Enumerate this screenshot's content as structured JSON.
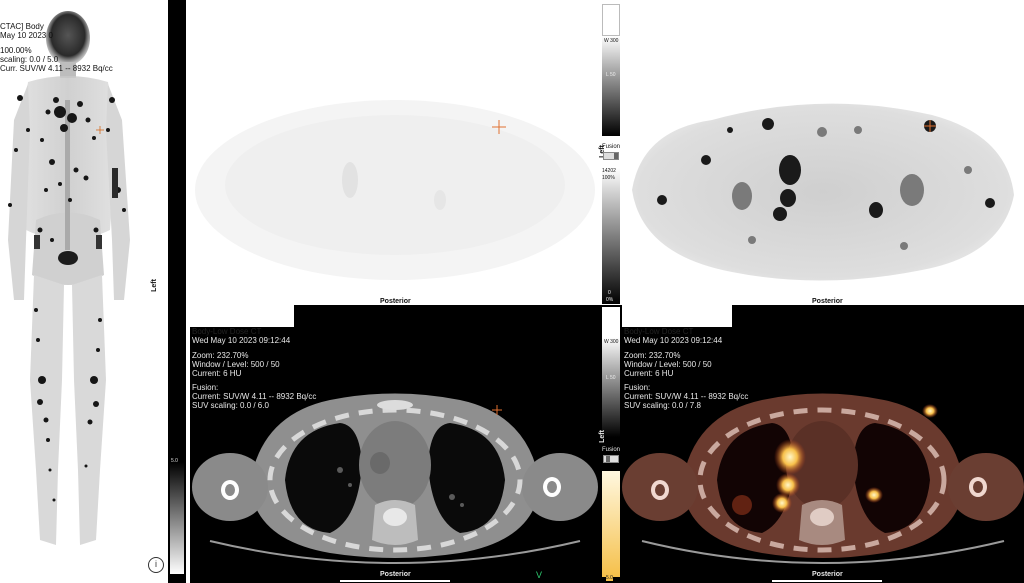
{
  "mip": {
    "header": {
      "line1": "CTAC] Body",
      "line2": "May 10 2023 0",
      "line3": "100.00%",
      "line4": "scaling: 0.0 / 5.0",
      "line5": "Curr. SUV/W 4.11 -- 8932 Bq/cc"
    },
    "scale_bottom": "5.0"
  },
  "pet_axial": {
    "orientation_left": "Left",
    "orientation_bottom": "Posterior"
  },
  "fused_pet_axial": {
    "orientation_bottom": "Posterior"
  },
  "top_colorbar": {
    "tick_top": "W 300",
    "tick_mid": "L 50",
    "orientation": "Left",
    "fusion_label": "Fusion"
  },
  "pet_colorbar": {
    "tick_top": "14202",
    "tick_top2": "100%",
    "tick_bottom": "0",
    "tick_bottom2": "0%"
  },
  "ct_axial": {
    "line1": "Body-Low Dose CT",
    "line2": "Wed May 10 2023 09:12:44",
    "line3": "Zoom: 232.70%",
    "line4": "Window / Level: 500 / 50",
    "line5": "Current: 6 HU",
    "line6": "Fusion:",
    "line7": "Current: SUV/W 4.11 -- 8932 Bq/cc",
    "line8": "SUV scaling: 0.0 / 6.0",
    "orientation_bottom": "Posterior"
  },
  "fusion_axial": {
    "line1": "Body-Low Dose CT",
    "line2": "Wed May 10 2023 09:12:44",
    "line3": "Zoom: 232.70%",
    "line4": "Window / Level: 500 / 50",
    "line5": "Current: 6 HU",
    "line6": "Fusion:",
    "line7": "Current: SUV/W 4.11 -- 8932 Bq/cc",
    "line8": "SUV scaling: 0.0 / 7.8",
    "orientation_bottom": "Posterior"
  },
  "bottom_colorbar": {
    "tick_top": "W 300",
    "tick_mid": "L 50",
    "orientation": "Left",
    "fusion_label": "Fusion",
    "tick_bottom": "5.0"
  },
  "left_strip": {
    "orientation": "Left",
    "tick_bottom": "5.0"
  }
}
